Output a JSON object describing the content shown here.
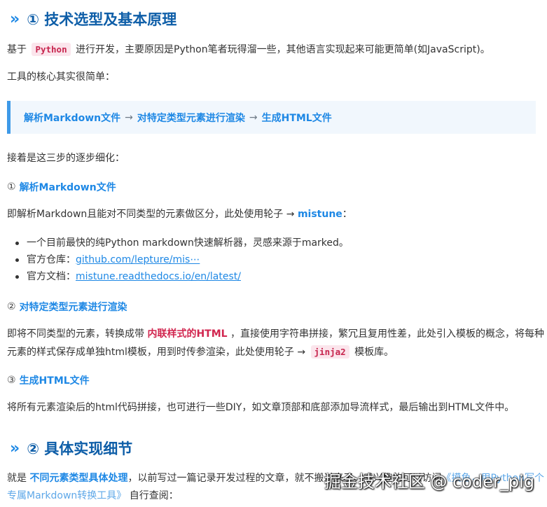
{
  "section1": {
    "marker": "»",
    "title": "① 技术选型及基本原理",
    "intro_before": "基于",
    "intro_code": "Python",
    "intro_after": "进行开发，主要原因是Python笔者玩得溜一些，其他语言实现起来可能更简单(如JavaScript)。",
    "core_text": "工具的核心其实很简单：",
    "quote": {
      "step1": "解析Markdown文件",
      "arrow": "→",
      "step2": "对特定类型元素进行渲染",
      "step3": "生成HTML文件"
    },
    "refine_text": "接着是这三步的逐步细化："
  },
  "step1": {
    "num": "①",
    "title": "解析Markdown文件",
    "desc_before": "即解析Markdown且能对不同类型的元素做区分，此处使用轮子 →",
    "desc_strong": "mistune",
    "desc_after": "：",
    "items": [
      {
        "text": "一个目前最快的纯Python markdown快速解析器，灵感来源于marked。",
        "link": ""
      },
      {
        "text": "官方仓库：",
        "link": "github.com/lepture/mis⋯"
      },
      {
        "text": "官方文档：",
        "link": "mistune.readthedocs.io/en/latest/"
      }
    ]
  },
  "step2": {
    "num": "②",
    "title": "对特定类型元素进行渲染",
    "desc_before": "即将不同类型的元素，转换成带",
    "desc_strong": "内联样式的HTML",
    "desc_mid": "，直接使用字符串拼接，繁冗且复用性差，此处引入模板的概念，将每种",
    "desc_line2": "元素的样式保存成单独html模板，用到时传参渲染，此处使用轮子 →",
    "desc_code": "jinja2",
    "desc_after": "模板库。"
  },
  "step3": {
    "num": "③",
    "title": "生成HTML文件",
    "desc": "将所有元素渲染后的html代码拼接，也可进行一些DIY，如文章顶部和底部添加导流样式，最后输出到HTML文件中。"
  },
  "section2": {
    "marker": "»",
    "title": "② 具体实现细节",
    "line1_before": "就是",
    "line1_strong": "不同元素类型具体处理",
    "line1_after": "，以前写过一篇记录开发过程的文章，就不搬过来了，感兴趣的可以访问",
    "line1_link": "《摸鱼，用Python写个",
    "line2_link": "专属Markdown转换工具》",
    "line2_after": "自行查阅："
  },
  "watermark": "掘金技术社区 @ coder_pig",
  "colors": {
    "heading": "#0e5ea8",
    "accent": "#1e88e5",
    "code_text": "#c7254e",
    "code_bg": "#fbe5ec",
    "quote_bg": "#f1f7fd",
    "quote_border": "#3e9ae8"
  }
}
